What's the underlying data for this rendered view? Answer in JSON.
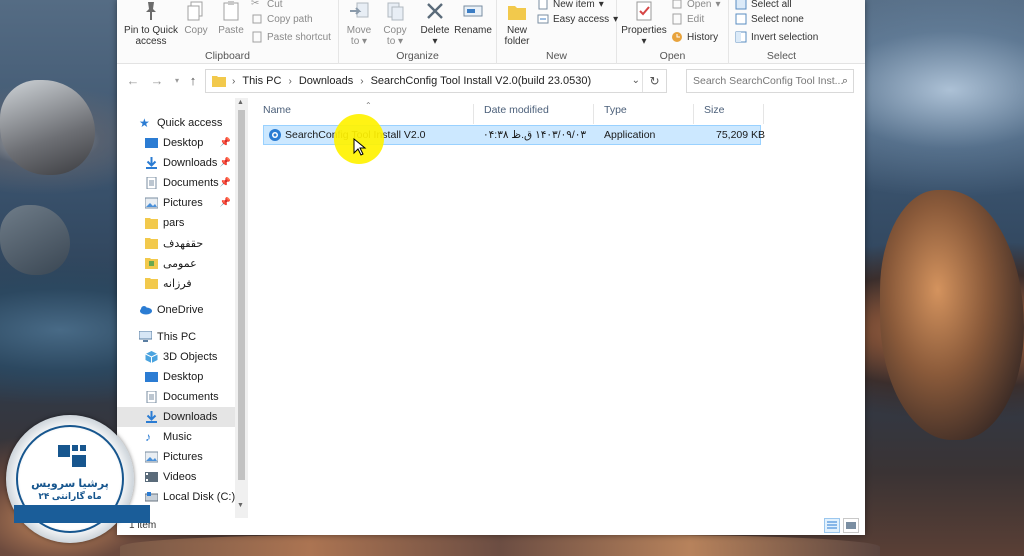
{
  "ribbon": {
    "clipboard": {
      "group_label": "Clipboard",
      "pin_label_1": "Pin to Quick",
      "pin_label_2": "access",
      "copy_label": "Copy",
      "paste_label": "Paste",
      "cut_label": "Cut",
      "copy_path_label": "Copy path",
      "paste_shortcut_label": "Paste shortcut"
    },
    "organize": {
      "group_label": "Organize",
      "move_label_1": "Move",
      "move_label_2": "to",
      "copy_label_1": "Copy",
      "copy_label_2": "to",
      "delete_label": "Delete",
      "rename_label": "Rename"
    },
    "new": {
      "group_label": "New",
      "new_folder_label_1": "New",
      "new_folder_label_2": "folder",
      "new_item_label": "New item",
      "easy_access_label": "Easy access"
    },
    "open": {
      "group_label": "Open",
      "properties_label": "Properties",
      "open_label": "Open",
      "edit_label": "Edit",
      "history_label": "History"
    },
    "select": {
      "group_label": "Select",
      "select_all_label": "Select all",
      "select_none_label": "Select none",
      "invert_selection_label": "Invert selection"
    }
  },
  "address": {
    "crumbs": [
      "This PC",
      "Downloads",
      "SearchConfig Tool Install V2.0(build 23.0530)"
    ],
    "search_placeholder": "Search SearchConfig Tool Inst..."
  },
  "nav": {
    "quick_access": "Quick access",
    "quick_items": [
      "Desktop",
      "Downloads",
      "Documents",
      "Pictures",
      "pars",
      "حقفهدف",
      "عمومی",
      "فرزانه"
    ],
    "onedrive": "OneDrive",
    "this_pc": "This PC",
    "pc_items": [
      "3D Objects",
      "Desktop",
      "Documents",
      "Downloads",
      "Music",
      "Pictures",
      "Videos",
      "Local Disk (C:)"
    ]
  },
  "columns": {
    "name": "Name",
    "date": "Date modified",
    "type": "Type",
    "size": "Size"
  },
  "files": [
    {
      "name": "SearchConfig Tool Install V2.0",
      "date": "۱۴۰۳/۰۹/۰۳ ق.ظ ۰۴:۳۸",
      "type": "Application",
      "size": "75,209 KB"
    }
  ],
  "status": {
    "item_count": "1 item"
  },
  "watermark": {
    "title": "پرشیا سرویس",
    "subtitle": "۲۴ ماه گارانتی"
  },
  "colors": {
    "selection": "#cce8ff",
    "folder": "#f2c94c",
    "accent_blue": "#2b7cd3"
  }
}
